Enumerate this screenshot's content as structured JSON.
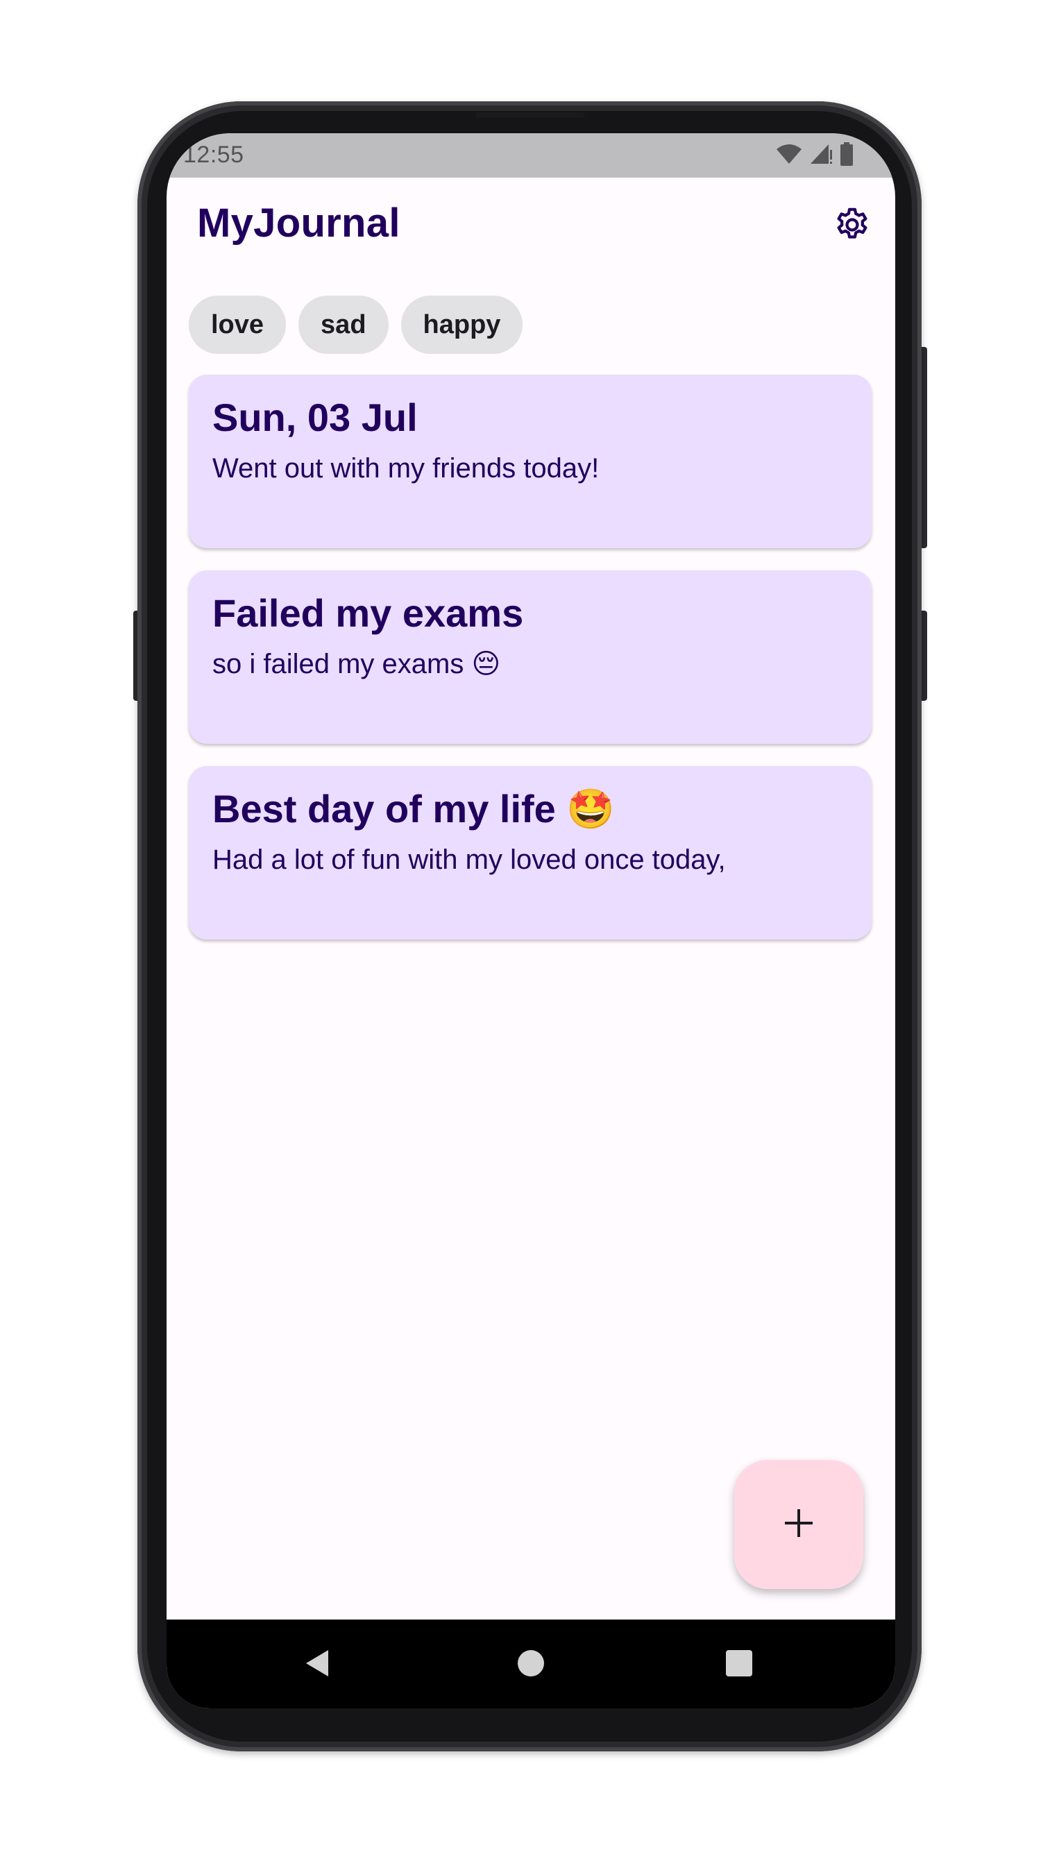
{
  "status_bar": {
    "time": "12:55",
    "icons": [
      "wifi-icon",
      "signal-icon",
      "battery-icon"
    ]
  },
  "app": {
    "title": "MyJournal",
    "settings_icon": "gear-icon"
  },
  "filter_chips": [
    {
      "label": "love"
    },
    {
      "label": "sad"
    },
    {
      "label": "happy"
    }
  ],
  "entries": [
    {
      "title": "Sun, 03 Jul",
      "body": "Went out with my friends today!"
    },
    {
      "title": "Failed my exams",
      "body": "so i failed my exams 😔"
    },
    {
      "title": "Best day of my life 🤩",
      "body": "Had a lot of fun with my loved once today,"
    }
  ],
  "fab": {
    "icon": "plus-icon"
  },
  "nav_bar": {
    "buttons": [
      "back-icon",
      "home-icon",
      "recents-icon"
    ]
  },
  "colors": {
    "primary_text": "#21005d",
    "card": "#eaddff",
    "chip": "#e2e1e3",
    "fab": "#ffd8e4",
    "background": "#fffbfe",
    "status_bar": "#bdbcbe"
  }
}
